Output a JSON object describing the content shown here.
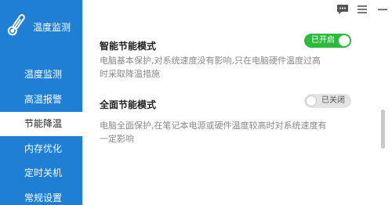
{
  "app": {
    "title": "温度监测",
    "logo_icon": "thermometer-icon"
  },
  "titlebar": {
    "feedback_icon": "chat-feedback-icon",
    "menu_icon": "menu-icon",
    "minimize_icon": "minimize-icon"
  },
  "sidebar": {
    "items": [
      {
        "label": "温度监测",
        "active": false
      },
      {
        "label": "高温报警",
        "active": false
      },
      {
        "label": "节能降温",
        "active": true
      },
      {
        "label": "内存优化",
        "active": false
      },
      {
        "label": "定时关机",
        "active": false
      },
      {
        "label": "常规设置",
        "active": false
      }
    ]
  },
  "sections": [
    {
      "title": "智能节能模式",
      "description": "电脑基本保护,对系统速度没有影响,只在电脑硬件温度过高时采取降温措施",
      "toggle": {
        "label": "已开启",
        "on": true
      }
    },
    {
      "title": "全面节能模式",
      "description": "电脑全面保护,在笔记本电源或硬件温度较高时对系统速度有一定影响",
      "toggle": {
        "label": "已关闭",
        "on": false
      }
    }
  ],
  "colors": {
    "sidebar": "#1f7fd4",
    "toggle_on": "#2dbb3d",
    "toggle_off": "#e3e3e3"
  }
}
